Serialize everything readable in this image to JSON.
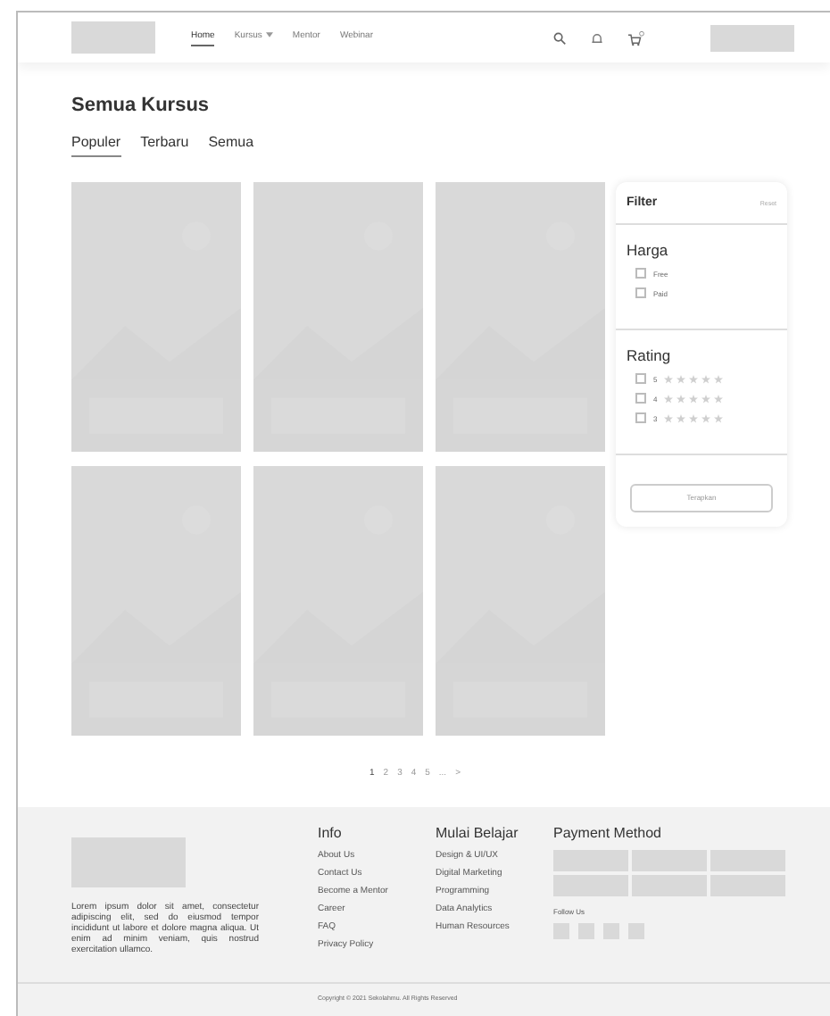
{
  "header": {
    "nav": [
      {
        "label": "Home",
        "selected": true,
        "dropdown": false
      },
      {
        "label": "Kursus",
        "selected": false,
        "dropdown": true
      },
      {
        "label": "Mentor",
        "selected": false,
        "dropdown": false
      },
      {
        "label": "Webinar",
        "selected": false,
        "dropdown": false
      }
    ],
    "cart_badge": true
  },
  "title": "Semua Kursus",
  "tabs": [
    {
      "label": "Populer",
      "selected": true
    },
    {
      "label": "Terbaru",
      "selected": false
    },
    {
      "label": "Semua",
      "selected": false
    }
  ],
  "filter": {
    "title": "Filter",
    "reset": "Reset",
    "sections": [
      {
        "title": "Harga",
        "options": [
          {
            "label": "Free",
            "checked": false
          },
          {
            "label": "Paid",
            "checked": false
          }
        ]
      },
      {
        "title": "Rating",
        "options": [
          {
            "label": "5",
            "checked": false,
            "stars": 0
          },
          {
            "label": "4",
            "checked": false,
            "stars": 0
          },
          {
            "label": "3",
            "checked": false,
            "stars": 0
          }
        ]
      }
    ],
    "apply": "Terapkan"
  },
  "pagination": {
    "pages": [
      {
        "label": "1",
        "selected": true
      },
      {
        "label": "2",
        "selected": false
      },
      {
        "label": "3",
        "selected": false
      },
      {
        "label": "4",
        "selected": false
      },
      {
        "label": "5",
        "selected": false
      },
      {
        "label": "...",
        "selected": false
      },
      {
        "label": ">",
        "selected": false
      }
    ]
  },
  "footer": {
    "description": "Lorem ipsum dolor sit amet, consectetur adipiscing elit, sed do eiusmod tempor incididunt ut labore et dolore magna aliqua. Ut enim ad minim veniam, quis nostrud exercitation ullamco.",
    "columns": [
      {
        "title": "Info",
        "links": [
          "About Us",
          "Contact Us",
          "Become a Mentor",
          "Career",
          "FAQ",
          "Privacy Policy"
        ]
      },
      {
        "title": "Mulai Belajar",
        "links": [
          "Design & UI/UX",
          "Digital Marketing",
          "Programming",
          "Data Analytics",
          "Human Resources"
        ]
      }
    ],
    "payment_title": "Payment Method",
    "follow_title": "Follow Us",
    "copyright": "Copyright © 2021 Sekolahmu. All Rights Reserved"
  }
}
